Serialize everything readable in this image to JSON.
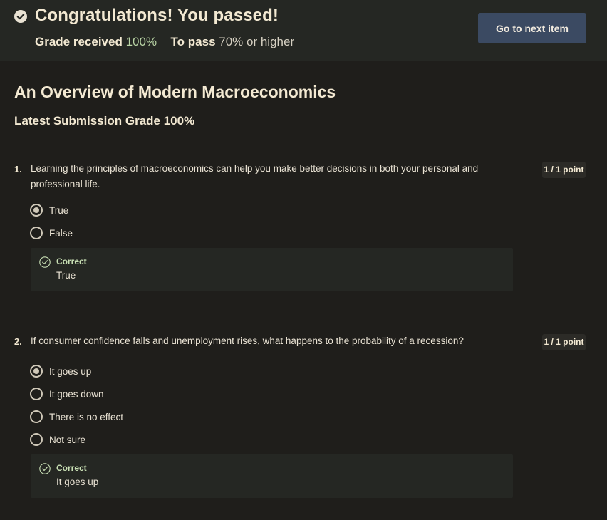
{
  "banner": {
    "title": "Congratulations! You passed!",
    "grade_label": "Grade received",
    "grade_value": "100%",
    "pass_label": "To pass",
    "pass_value": "70% or higher",
    "next_button": "Go to next item",
    "check_icon": "check-circle-icon"
  },
  "assignment": {
    "title": "An Overview of Modern Macroeconomics",
    "latest_grade": "Latest Submission Grade 100%"
  },
  "questions": [
    {
      "number": "1.",
      "text": "Learning the principles of macroeconomics can help you make better decisions in both your personal and professional life.",
      "points": "1 / 1 point",
      "options": [
        {
          "label": "True",
          "selected": true
        },
        {
          "label": "False",
          "selected": false
        }
      ],
      "feedback": {
        "status": "Correct",
        "answer": "True"
      }
    },
    {
      "number": "2.",
      "text": "If consumer confidence falls and unemployment rises, what happens to the probability of a recession?",
      "points": "1 / 1 point",
      "options": [
        {
          "label": "It goes up",
          "selected": true
        },
        {
          "label": "It goes down",
          "selected": false
        },
        {
          "label": "There is no effect",
          "selected": false
        },
        {
          "label": "Not sure",
          "selected": false
        }
      ],
      "feedback": {
        "status": "Correct",
        "answer": "It goes up"
      }
    }
  ],
  "colors": {
    "background": "#1f1e1b",
    "banner": "#252723",
    "button": "#3b4a62",
    "correct": "#c9e0b5",
    "grade_accent": "#b9d4a5"
  }
}
